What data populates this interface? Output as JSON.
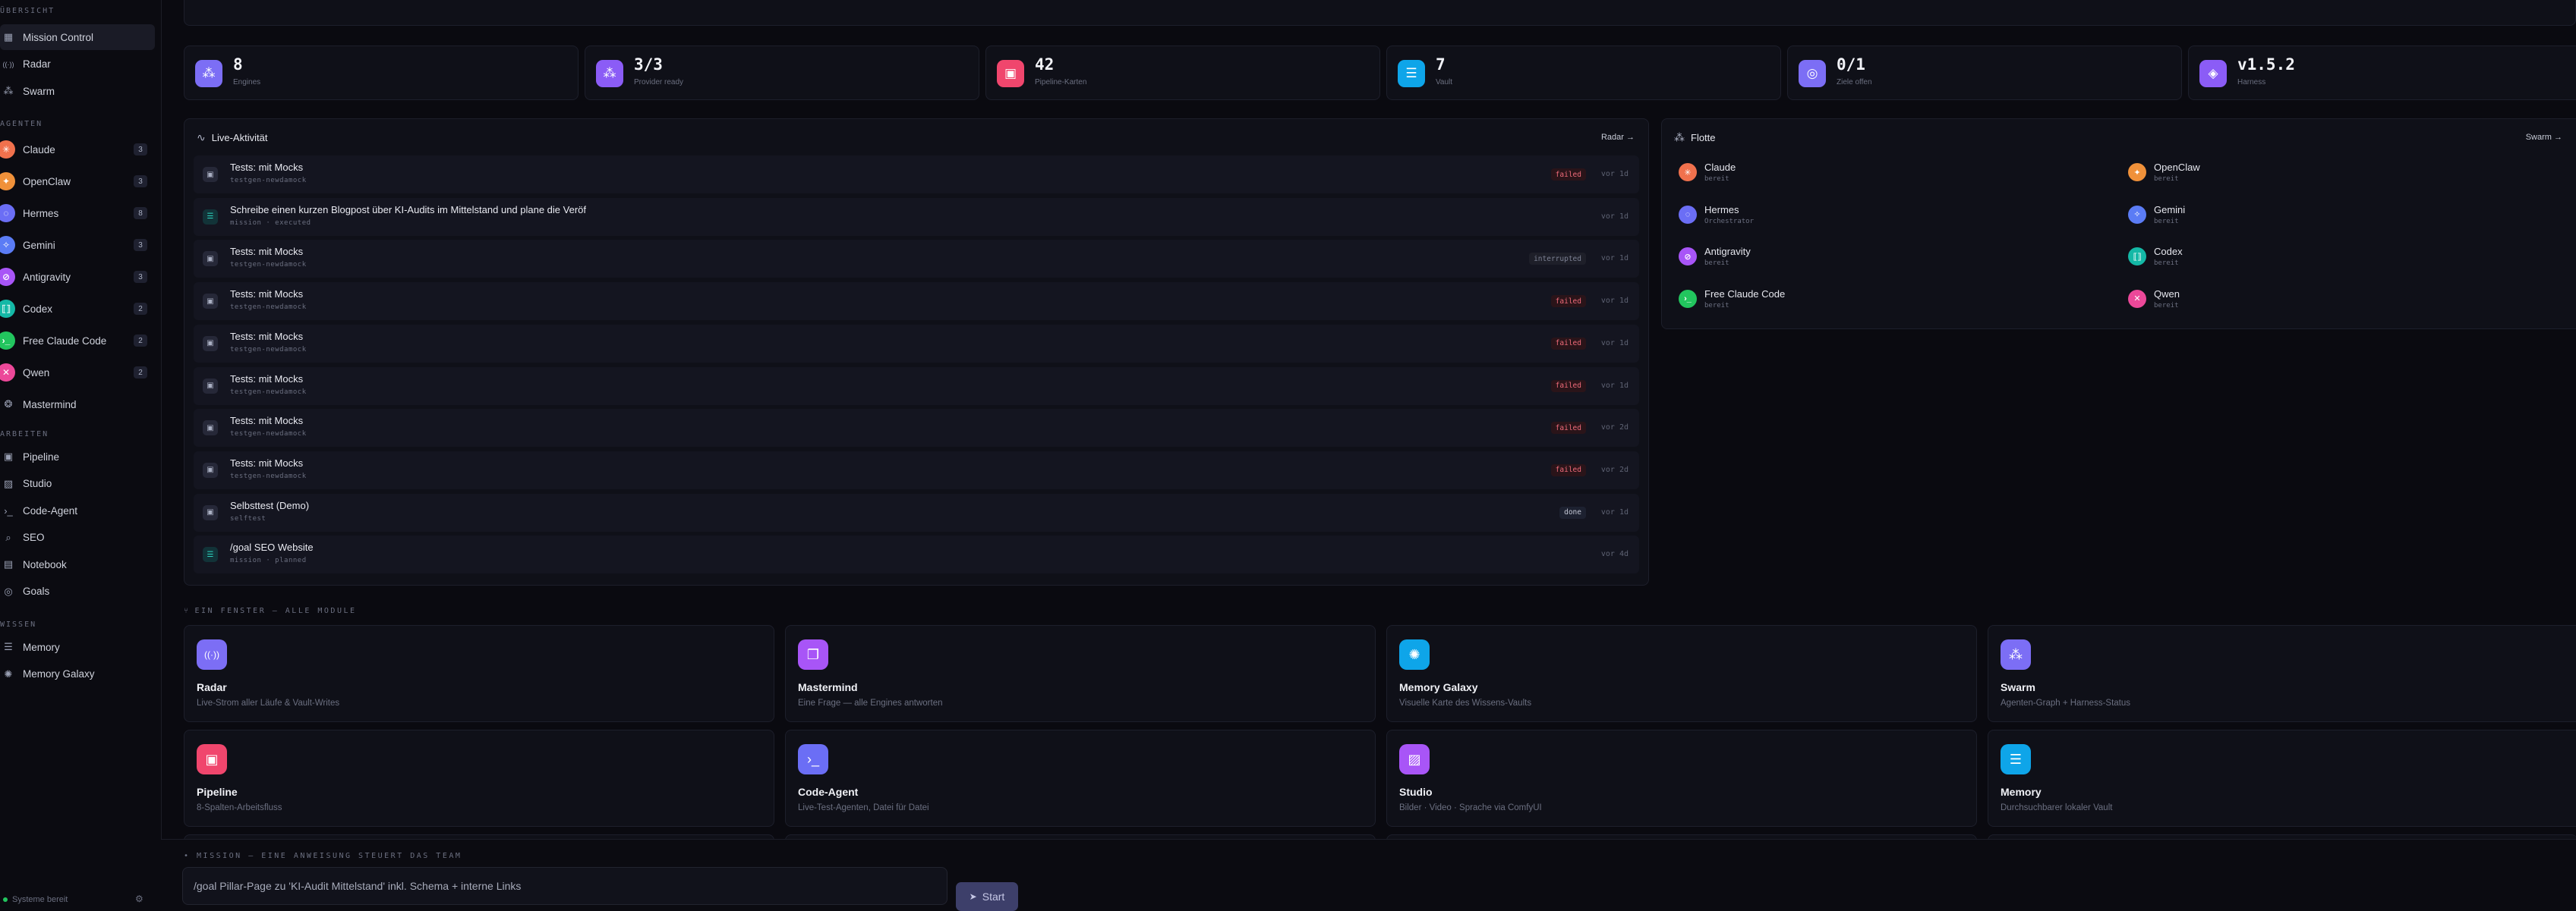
{
  "sidebar": {
    "sections": {
      "overview": "ÜBERSICHT",
      "agents": "AGENTEN",
      "work": "ARBEITEN",
      "knowledge": "WISSEN"
    },
    "overview_items": [
      {
        "label": "Mission Control",
        "icon": "grid-icon",
        "active": true
      },
      {
        "label": "Radar",
        "icon": "radar-icon"
      },
      {
        "label": "Swarm",
        "icon": "swarm-icon"
      }
    ],
    "agents": [
      {
        "label": "Claude",
        "count": "3",
        "color": "#f0714d"
      },
      {
        "label": "OpenClaw",
        "count": "3",
        "color": "#f0913a"
      },
      {
        "label": "Hermes",
        "count": "8",
        "color": "#6b6ef5"
      },
      {
        "label": "Gemini",
        "count": "3",
        "color": "#5b7cf5"
      },
      {
        "label": "Antigravity",
        "count": "3",
        "color": "#a855f7"
      },
      {
        "label": "Codex",
        "count": "2",
        "color": "#14b8a6"
      },
      {
        "label": "Free Claude Code",
        "count": "2",
        "color": "#22c55e"
      },
      {
        "label": "Qwen",
        "count": "2",
        "color": "#ec4899"
      },
      {
        "label": "Mastermind",
        "count": "",
        "color": ""
      }
    ],
    "work_items": [
      {
        "label": "Pipeline",
        "icon": "pipeline-icon"
      },
      {
        "label": "Studio",
        "icon": "image-icon"
      },
      {
        "label": "Code-Agent",
        "icon": "terminal-icon"
      },
      {
        "label": "SEO",
        "icon": "search-icon"
      },
      {
        "label": "Notebook",
        "icon": "notebook-icon"
      },
      {
        "label": "Goals",
        "icon": "target-icon"
      }
    ],
    "knowledge_items": [
      {
        "label": "Memory",
        "icon": "database-icon"
      },
      {
        "label": "Memory Galaxy",
        "icon": "galaxy-icon"
      }
    ],
    "status": "Systeme bereit"
  },
  "stats": [
    {
      "value": "8",
      "label": "Engines",
      "color": "#7c6ef5",
      "icon": "swarm-icon"
    },
    {
      "value": "3/3",
      "label": "Provider ready",
      "color": "#8b5cf6",
      "icon": "swarm-icon"
    },
    {
      "value": "42",
      "label": "Pipeline-Karten",
      "color": "#f0466d",
      "icon": "pipeline-icon"
    },
    {
      "value": "7",
      "label": "Vault",
      "color": "#0ea5e9",
      "icon": "database-icon"
    },
    {
      "value": "0/1",
      "label": "Ziele offen",
      "color": "#7c6ef5",
      "icon": "target-icon"
    },
    {
      "value": "v1.5.2",
      "label": "Harness",
      "color": "#8b5cf6",
      "icon": "box-icon"
    }
  ],
  "activity": {
    "title": "Live-Aktivität",
    "link": "Radar →",
    "rows": [
      {
        "title": "Tests: mit Mocks",
        "sub": "testgen-newdamock",
        "badge": "failed",
        "badge_type": "failed",
        "time": "vor 1d",
        "kind": "task"
      },
      {
        "title": "Schreibe einen kurzen Blogpost über KI-Audits im Mittelstand und plane die Veröf",
        "sub": "mission · executed",
        "badge": "",
        "badge_type": "",
        "time": "vor 1d",
        "kind": "mission"
      },
      {
        "title": "Tests: mit Mocks",
        "sub": "testgen-newdamock",
        "badge": "interrupted",
        "badge_type": "int",
        "time": "vor 1d",
        "kind": "task"
      },
      {
        "title": "Tests: mit Mocks",
        "sub": "testgen-newdamock",
        "badge": "failed",
        "badge_type": "failed",
        "time": "vor 1d",
        "kind": "task"
      },
      {
        "title": "Tests: mit Mocks",
        "sub": "testgen-newdamock",
        "badge": "failed",
        "badge_type": "failed",
        "time": "vor 1d",
        "kind": "task"
      },
      {
        "title": "Tests: mit Mocks",
        "sub": "testgen-newdamock",
        "badge": "failed",
        "badge_type": "failed",
        "time": "vor 1d",
        "kind": "task"
      },
      {
        "title": "Tests: mit Mocks",
        "sub": "testgen-newdamock",
        "badge": "failed",
        "badge_type": "failed",
        "time": "vor 2d",
        "kind": "task"
      },
      {
        "title": "Tests: mit Mocks",
        "sub": "testgen-newdamock",
        "badge": "failed",
        "badge_type": "failed",
        "time": "vor 2d",
        "kind": "task"
      },
      {
        "title": "Selbsttest (Demo)",
        "sub": "selftest",
        "badge": "done",
        "badge_type": "done",
        "time": "vor 1d",
        "kind": "task"
      },
      {
        "title": "/goal SEO Website",
        "sub": "mission · planned",
        "badge": "",
        "badge_type": "",
        "time": "vor 4d",
        "kind": "mission"
      }
    ]
  },
  "fleet": {
    "title": "Flotte",
    "link": "Swarm →",
    "items": [
      {
        "name": "Claude",
        "status": "bereit",
        "color": "#f0714d"
      },
      {
        "name": "OpenClaw",
        "status": "bereit",
        "color": "#f0913a"
      },
      {
        "name": "Hermes",
        "status": "Orchestrator",
        "color": "#6b6ef5"
      },
      {
        "name": "Gemini",
        "status": "bereit",
        "color": "#5b7cf5"
      },
      {
        "name": "Antigravity",
        "status": "bereit",
        "color": "#a855f7"
      },
      {
        "name": "Codex",
        "status": "bereit",
        "color": "#14b8a6"
      },
      {
        "name": "Free Claude Code",
        "status": "bereit",
        "color": "#22c55e"
      },
      {
        "name": "Qwen",
        "status": "bereit",
        "color": "#ec4899"
      }
    ]
  },
  "modules": {
    "label": "EIN FENSTER — ALLE MODULE",
    "items": [
      {
        "title": "Radar",
        "desc": "Live-Strom aller Läufe & Vault-Writes",
        "color": "#7c6ef5",
        "icon": "radar-icon"
      },
      {
        "title": "Mastermind",
        "desc": "Eine Frage — alle Engines antworten",
        "color": "#a855f7",
        "icon": "chat-icon"
      },
      {
        "title": "Memory Galaxy",
        "desc": "Visuelle Karte des Wissens-Vaults",
        "color": "#0ea5e9",
        "icon": "galaxy-icon"
      },
      {
        "title": "Swarm",
        "desc": "Agenten-Graph + Harness-Status",
        "color": "#7c6ef5",
        "icon": "swarm-icon"
      },
      {
        "title": "Pipeline",
        "desc": "8-Spalten-Arbeitsfluss",
        "color": "#f0466d",
        "icon": "pipeline-icon"
      },
      {
        "title": "Code-Agent",
        "desc": "Live-Test-Agenten, Datei für Datei",
        "color": "#6b6ef5",
        "icon": "terminal-icon"
      },
      {
        "title": "Studio",
        "desc": "Bilder · Video · Sprache via ComfyUI",
        "color": "#a855f7",
        "icon": "image-icon"
      },
      {
        "title": "Memory",
        "desc": "Durchsuchbarer lokaler Vault",
        "color": "#0ea5e9",
        "icon": "database-icon"
      }
    ]
  },
  "mission": {
    "label": "• MISSION — EINE ANWEISUNG STEUERT DAS TEAM",
    "placeholder": "/goal Pillar-Page zu 'KI-Audit Mittelstand' inkl. Schema + interne Links",
    "start": "Start"
  }
}
